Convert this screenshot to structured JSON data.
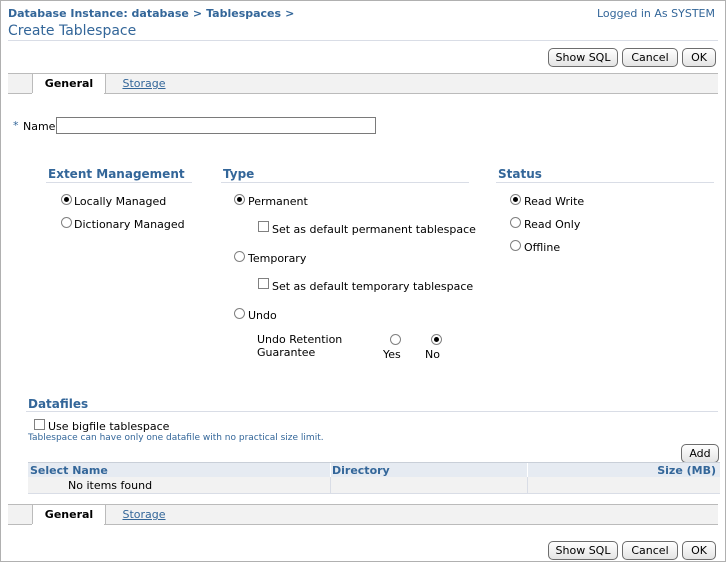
{
  "breadcrumb": {
    "item1": "Database Instance: database",
    "sep1": ">",
    "item2": "Tablespaces",
    "sep2": ">"
  },
  "logged_in": "Logged in As SYSTEM",
  "page_title": "Create Tablespace",
  "buttons": {
    "show_sql": "Show SQL",
    "cancel": "Cancel",
    "ok": "OK",
    "add": "Add"
  },
  "tabs": {
    "general": "General",
    "storage": "Storage"
  },
  "name_field": {
    "required_marker": "*",
    "label": "Name",
    "value": ""
  },
  "extent_management": {
    "title": "Extent Management",
    "options": [
      {
        "label": "Locally Managed",
        "selected": true
      },
      {
        "label": "Dictionary Managed",
        "selected": false
      }
    ]
  },
  "type": {
    "title": "Type",
    "permanent": "Permanent",
    "permanent_default": "Set as default permanent tablespace",
    "temporary": "Temporary",
    "temporary_default": "Set as default temporary tablespace",
    "undo": "Undo",
    "undo_retention_line1": "Undo Retention",
    "undo_retention_line2": "Guarantee",
    "yes": "Yes",
    "no": "No",
    "selected": "Permanent",
    "undo_retention_selected": "No"
  },
  "status": {
    "title": "Status",
    "options": [
      {
        "label": "Read Write",
        "selected": true
      },
      {
        "label": "Read Only",
        "selected": false
      },
      {
        "label": "Offline",
        "selected": false
      }
    ]
  },
  "datafiles": {
    "title": "Datafiles",
    "bigfile_label": "Use bigfile tablespace",
    "bigfile_hint": "Tablespace can have only one datafile with no practical size limit.",
    "columns": [
      "Select Name",
      "Directory",
      "Size (MB)"
    ],
    "empty_message": "No items found"
  }
}
